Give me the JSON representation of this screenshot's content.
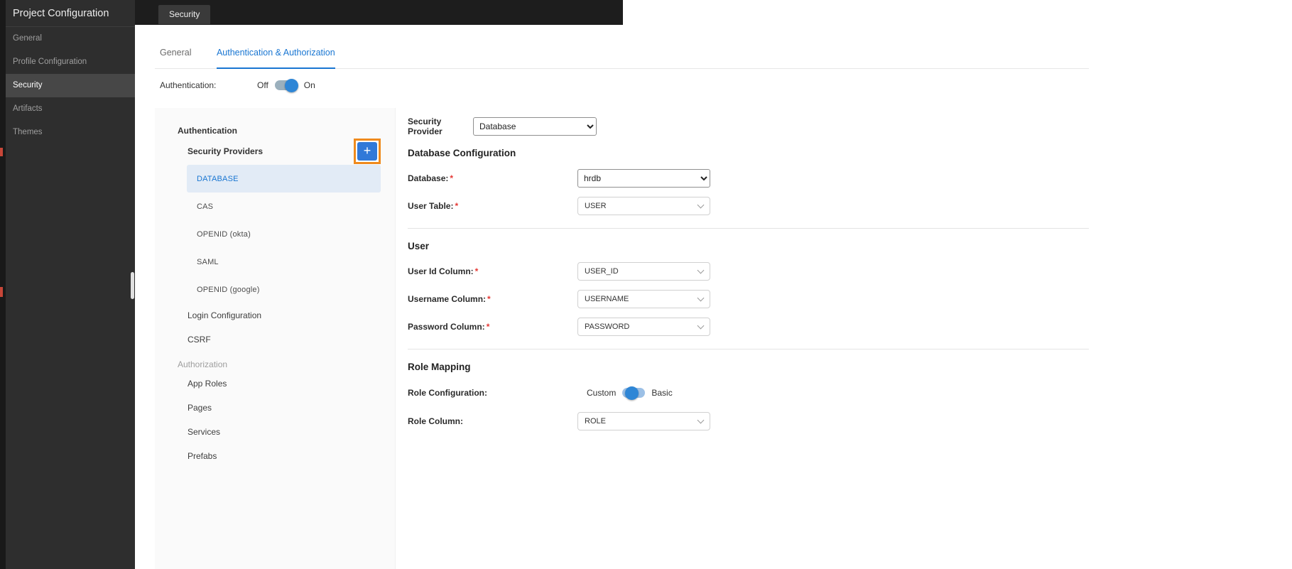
{
  "sidebar": {
    "title": "Project Configuration",
    "items": [
      {
        "label": "General"
      },
      {
        "label": "Profile Configuration"
      },
      {
        "label": "Security"
      },
      {
        "label": "Artifacts"
      },
      {
        "label": "Themes"
      }
    ],
    "active_item": "Security"
  },
  "topbar": {
    "active_tab": "Security"
  },
  "page_tabs": {
    "general": "General",
    "auth": "Authentication & Authorization",
    "active": "Authentication & Authorization"
  },
  "auth_toggle": {
    "label": "Authentication:",
    "off_label": "Off",
    "on_label": "On",
    "state": "On"
  },
  "nav": {
    "authentication_heading": "Authentication",
    "security_providers_heading": "Security Providers",
    "providers": [
      {
        "label": "DATABASE"
      },
      {
        "label": "CAS"
      },
      {
        "label": "OPENID (okta)"
      },
      {
        "label": "SAML"
      },
      {
        "label": "OPENID (google)"
      }
    ],
    "selected_provider": "DATABASE",
    "login_configuration_label": "Login Configuration",
    "csrf_label": "CSRF",
    "authorization_heading": "Authorization",
    "authorization_items": [
      {
        "label": "App Roles"
      },
      {
        "label": "Pages"
      },
      {
        "label": "Services"
      },
      {
        "label": "Prefabs"
      }
    ]
  },
  "form": {
    "security_provider": {
      "label": "Security Provider",
      "value": "Database"
    },
    "database_configuration": {
      "heading": "Database Configuration",
      "database": {
        "label": "Database:",
        "required": "*",
        "value": "hrdb"
      },
      "user_table": {
        "label": "User Table:",
        "required": "*",
        "value": "USER"
      }
    },
    "user": {
      "heading": "User",
      "user_id_column": {
        "label": "User Id Column:",
        "required": "*",
        "value": "USER_ID"
      },
      "username_column": {
        "label": "Username Column:",
        "required": "*",
        "value": "USERNAME"
      },
      "password_column": {
        "label": "Password Column:",
        "required": "*",
        "value": "PASSWORD"
      }
    },
    "role_mapping": {
      "heading": "Role Mapping",
      "role_configuration": {
        "label": "Role Configuration:",
        "left_label": "Custom",
        "right_label": "Basic"
      },
      "role_column": {
        "label": "Role Column:",
        "value": "ROLE"
      }
    }
  },
  "icons": {
    "plus": "+"
  },
  "colors": {
    "accent": "#1976d2",
    "annotation_highlight": "#ef8a1d",
    "selected_row_bg": "#e2ebf6"
  }
}
